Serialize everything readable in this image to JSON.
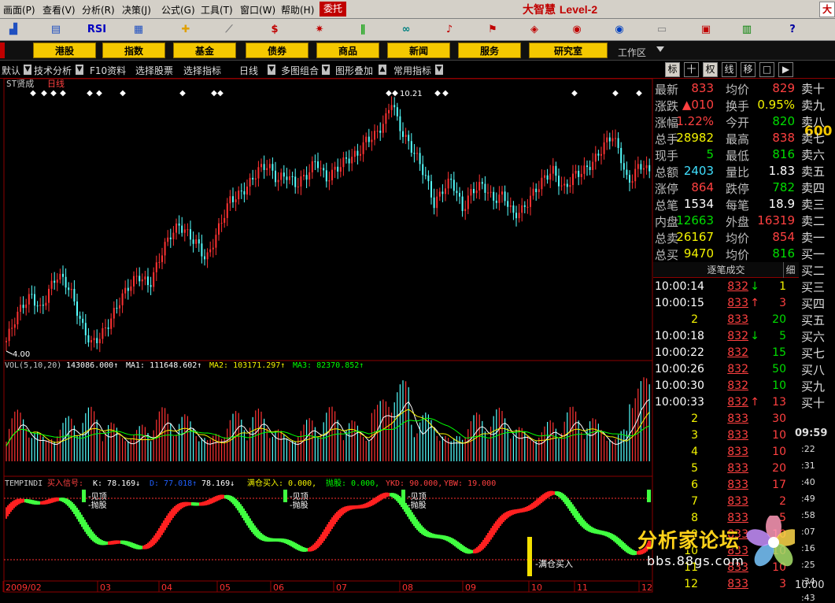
{
  "menu": {
    "items": [
      "画面(P)",
      "查看(V)",
      "分析(R)",
      "决策(J)",
      "公式(G)",
      "工具(T)",
      "窗口(W)",
      "帮助(H)"
    ],
    "wt": "委托",
    "brand": "大智慧",
    "level": "Level-2",
    "corner": "大"
  },
  "toolbar": {
    "icons": [
      "chart-icon",
      "tick-icon",
      "rsi-icon",
      "quote-list-icon",
      "crosshair-icon",
      "ruler-icon",
      "dollar-icon",
      "sign-icon",
      "bars-icon",
      "binoculars-icon",
      "bell-icon",
      "flag-icon",
      "diamond-icon",
      "stock-a-icon",
      "stock-b-icon",
      "blank-icon",
      "keyboard-icon",
      "window-icon",
      "books-icon",
      "help-icon"
    ],
    "rsi": "RSI"
  },
  "categories": {
    "items": [
      "港股",
      "指数",
      "基金",
      "债券",
      "商品",
      "新闻",
      "服务",
      "研究室"
    ],
    "workspace": "工作区"
  },
  "tabbar": {
    "items": [
      "默认",
      "技术分析",
      "F10资料",
      "选择股票",
      "选择指标",
      "日线",
      "多图组合",
      "图形叠加",
      "常用指标"
    ],
    "right": [
      "标",
      "十",
      "权",
      "线",
      "移",
      "□",
      "▶"
    ],
    "code": "600"
  },
  "chart": {
    "title_name": "ST贤成",
    "title_period": "日线",
    "low_label": "4.00",
    "high_label": "10.21",
    "vol_header": {
      "name": "VOL(5,10,20)",
      "vol": "143086.000↑",
      "ma1": "MA1: 111648.602↑",
      "ma2": "MA2: 103171.297↑",
      "ma3": "MA3: 82370.852↑"
    },
    "ind_header": {
      "name": "TEMPINDI",
      "sig": "买入信号:",
      "k": "K: 78.169↓",
      "d": "D: 77.018↑",
      "j": "78.169↓",
      "mc": "满仓买入: 0.000,",
      "pg": "抛股: 0.000,",
      "ykd": "YKD: 90.000,",
      "ybw": "YBW: 19.000"
    },
    "top_labels": [
      "-见顶",
      "-抛股"
    ],
    "buy_label": "-满仓买入",
    "months": [
      "2009/02",
      "03",
      "04",
      "05",
      "06",
      "07",
      "08",
      "09",
      "10",
      "11",
      "12"
    ],
    "colors": {
      "up": "#ff3232",
      "down": "#54ffff",
      "ma1": "#ffffff",
      "ma2": "#f4f400",
      "ma3": "#00ff00"
    }
  },
  "quotes": [
    {
      "l1": "最新",
      "v1": "833",
      "c1": "up",
      "l2": "均价",
      "v2": "829",
      "c2": "up"
    },
    {
      "l1": "涨跌",
      "v1": "▲010",
      "c1": "up",
      "l2": "换手",
      "v2": "0.95%",
      "c2": "yl"
    },
    {
      "l1": "涨幅",
      "v1": "1.22%",
      "c1": "up",
      "l2": "今开",
      "v2": "820",
      "c2": "dn"
    },
    {
      "l1": "总手",
      "v1": "28982",
      "c1": "yl",
      "l2": "最高",
      "v2": "838",
      "c2": "up"
    },
    {
      "l1": "现手",
      "v1": "5",
      "c1": "dn",
      "l2": "最低",
      "v2": "816",
      "c2": "dn"
    },
    {
      "l1": "总额",
      "v1": "2403",
      "c1": "cy",
      "l2": "量比",
      "v2": "1.83",
      "c2": "wt"
    },
    {
      "l1": "涨停",
      "v1": "864",
      "c1": "up",
      "l2": "跌停",
      "v2": "782",
      "c2": "dn"
    },
    {
      "l1": "总笔",
      "v1": "1534",
      "c1": "wt",
      "l2": "每笔",
      "v2": "18.9",
      "c2": "wt"
    },
    {
      "l1": "内盘",
      "v1": "12663",
      "c1": "dn",
      "l2": "外盘",
      "v2": "16319",
      "c2": "up"
    },
    {
      "l1": "总卖",
      "v1": "26167",
      "c1": "yl",
      "l2": "均价",
      "v2": "854",
      "c2": "up"
    },
    {
      "l1": "总买",
      "v1": "9470",
      "c1": "yl",
      "l2": "均价",
      "v2": "816",
      "c2": "dn"
    }
  ],
  "trades": {
    "header": "逐笔成交",
    "detail": "细",
    "rows": [
      {
        "t": "10:00:14",
        "p": "832",
        "a": "↓",
        "v": "1",
        "pc": "up",
        "vc": "yl"
      },
      {
        "t": "10:00:15",
        "p": "833",
        "a": "↑",
        "v": "3",
        "pc": "up",
        "vc": "up"
      },
      {
        "t": "2",
        "p": "833",
        "a": "",
        "v": "20",
        "pc": "up",
        "vc": "dn"
      },
      {
        "t": "10:00:18",
        "p": "832",
        "a": "↓",
        "v": "5",
        "pc": "up",
        "vc": "dn"
      },
      {
        "t": "10:00:22",
        "p": "832",
        "a": "",
        "v": "15",
        "pc": "up",
        "vc": "dn"
      },
      {
        "t": "10:00:26",
        "p": "832",
        "a": "",
        "v": "50",
        "pc": "up",
        "vc": "dn"
      },
      {
        "t": "10:00:30",
        "p": "832",
        "a": "",
        "v": "10",
        "pc": "up",
        "vc": "dn"
      },
      {
        "t": "10:00:33",
        "p": "832",
        "a": "↑",
        "v": "13",
        "pc": "up",
        "vc": "up"
      },
      {
        "t": "2",
        "p": "833",
        "a": "",
        "v": "30",
        "pc": "up",
        "vc": "up"
      },
      {
        "t": "3",
        "p": "833",
        "a": "",
        "v": "10",
        "pc": "up",
        "vc": "up"
      },
      {
        "t": "4",
        "p": "833",
        "a": "",
        "v": "10",
        "pc": "up",
        "vc": "up"
      },
      {
        "t": "5",
        "p": "833",
        "a": "",
        "v": "20",
        "pc": "up",
        "vc": "up"
      },
      {
        "t": "6",
        "p": "833",
        "a": "",
        "v": "17",
        "pc": "up",
        "vc": "up"
      },
      {
        "t": "7",
        "p": "833",
        "a": "",
        "v": "2",
        "pc": "up",
        "vc": "up"
      },
      {
        "t": "8",
        "p": "833",
        "a": "",
        "v": "5",
        "pc": "up",
        "vc": "up"
      },
      {
        "t": "9",
        "p": "833",
        "a": "",
        "v": "10",
        "pc": "up",
        "vc": "up"
      },
      {
        "t": "10",
        "p": "833",
        "a": "",
        "v": "10",
        "pc": "up",
        "vc": "up"
      },
      {
        "t": "11",
        "p": "833",
        "a": "",
        "v": "10",
        "pc": "up",
        "vc": "up"
      },
      {
        "t": "12",
        "p": "833",
        "a": "",
        "v": "3",
        "pc": "up",
        "vc": "up"
      }
    ]
  },
  "levels": [
    "卖十",
    "卖九",
    "卖八",
    "卖七",
    "卖六",
    "卖五",
    "卖四",
    "卖三",
    "卖二",
    "卖一",
    "买一",
    "买二",
    "买三",
    "买四",
    "买五",
    "买六",
    "买七",
    "买八",
    "买九",
    "买十"
  ],
  "right_times": [
    "09:59",
    ":22",
    ":31",
    ":40",
    ":49",
    ":58",
    ":07",
    ":16",
    ":25",
    ":34",
    ":43",
    "10:00"
  ],
  "watermark": {
    "title": "分析家论坛",
    "url": "bbs.88gs.com"
  }
}
